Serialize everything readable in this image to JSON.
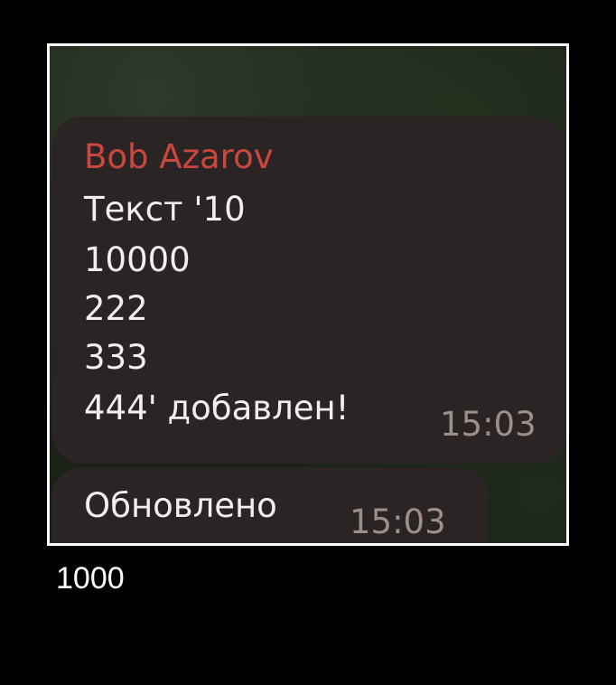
{
  "messages": [
    {
      "sender": "Bob Azarov",
      "lines": [
        "Текст '10",
        "10000",
        "222",
        "333",
        "444' добавлен!"
      ],
      "time": "15:03"
    },
    {
      "lines": [
        "Обновлено"
      ],
      "time": "15:03"
    }
  ],
  "caption": "1000",
  "colors": {
    "sender_name": "#c9473f",
    "bubble": "#2a2425",
    "message_text": "#f2f0ee",
    "timestamp": "#9a8f89",
    "frame_border": "#ffffff",
    "outer_background": "#000000"
  }
}
